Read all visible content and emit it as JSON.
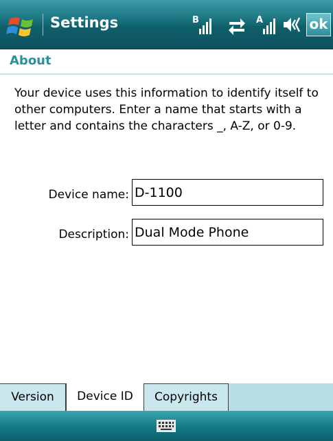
{
  "titlebar": {
    "title": "Settings",
    "start_icon": "windows-flag-icon",
    "status_icons": [
      "bluetooth-signal-icon",
      "data-sync-icon",
      "signal-strength-icon",
      "volume-icon"
    ],
    "ok_label": "ok"
  },
  "header": {
    "title": "About"
  },
  "intro": "Your device uses this information to identify itself to other computers. Enter a name that starts with a letter and contains the characters _, A-Z, or 0-9.",
  "form": {
    "device_name_label": "Device name:",
    "device_name_value": "D-1100",
    "description_label": "Description:",
    "description_value": "Dual Mode Phone"
  },
  "tabs": [
    {
      "label": "Version",
      "active": false
    },
    {
      "label": "Device ID",
      "active": true
    },
    {
      "label": "Copyrights",
      "active": false
    }
  ],
  "bottombar": {
    "icon": "keyboard-icon"
  },
  "colors": {
    "titlebar": "#1f7a86",
    "header_text": "#2a8fa0",
    "tabstrip": "#b8dfe6"
  }
}
